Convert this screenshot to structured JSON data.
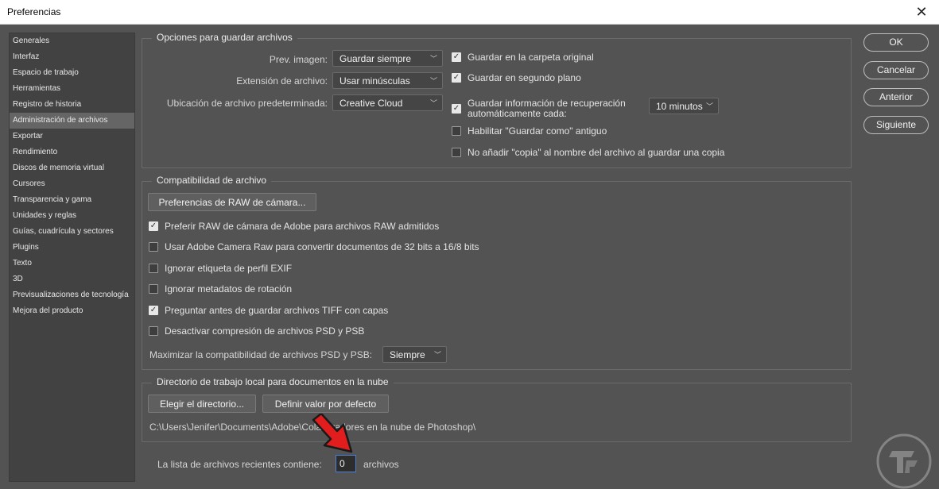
{
  "window": {
    "title": "Preferencias",
    "close": "✕"
  },
  "sidebar": {
    "items": [
      "Generales",
      "Interfaz",
      "Espacio de trabajo",
      "Herramientas",
      "Registro de historia",
      "Administración de archivos",
      "Exportar",
      "Rendimiento",
      "Discos de memoria virtual",
      "Cursores",
      "Transparencia y gama",
      "Unidades y reglas",
      "Guías, cuadrícula y sectores",
      "Plugins",
      "Texto",
      "3D",
      "Previsualizaciones de tecnología",
      "Mejora del producto"
    ],
    "selected_index": 5
  },
  "save_options": {
    "legend": "Opciones para guardar archivos",
    "prev_label": "Prev. imagen:",
    "prev_value": "Guardar siempre",
    "ext_label": "Extensión de archivo:",
    "ext_value": "Usar minúsculas",
    "loc_label": "Ubicación de archivo predeterminada:",
    "loc_value": "Creative Cloud",
    "cb_original": "Guardar en la carpeta original",
    "cb_background": "Guardar en segundo plano",
    "cb_recovery_l1": "Guardar información de recuperación",
    "cb_recovery_l2": "automáticamente cada:",
    "recovery_interval": "10 minutos",
    "cb_legacy": "Habilitar \"Guardar como\" antiguo",
    "cb_nocopy": "No añadir \"copia\" al nombre del archivo al guardar una copia",
    "checked": {
      "original": true,
      "background": true,
      "recovery": true,
      "legacy": false,
      "nocopy": false
    }
  },
  "compat": {
    "legend": "Compatibilidad de archivo",
    "raw_button": "Preferencias de RAW de cámara...",
    "cb_prefer_raw": "Preferir RAW de cámara de Adobe para archivos RAW admitidos",
    "cb_use_acr": "Usar Adobe Camera Raw para convertir documentos de 32 bits a 16/8 bits",
    "cb_exif": "Ignorar etiqueta de perfil EXIF",
    "cb_rotation": "Ignorar metadatos de rotación",
    "cb_tiff": "Preguntar antes de guardar archivos TIFF con capas",
    "cb_psd_comp": "Desactivar compresión de archivos PSD y PSB",
    "maximize_label": "Maximizar la compatibilidad de archivos PSD y PSB:",
    "maximize_value": "Siempre",
    "checked": {
      "prefer_raw": true,
      "use_acr": false,
      "exif": false,
      "rotation": false,
      "tiff": true,
      "psd_comp": false
    }
  },
  "cloud": {
    "legend": "Directorio de trabajo local para documentos en la nube",
    "choose_button": "Elegir el directorio...",
    "default_button": "Definir valor por defecto",
    "path": "C:\\Users\\Jenifer\\Documents\\Adobe\\Colaboradores en la nube de Photoshop\\"
  },
  "recent": {
    "label": "La lista de archivos recientes contiene:",
    "value": "0",
    "unit": "archivos"
  },
  "buttons": {
    "ok": "OK",
    "cancel": "Cancelar",
    "previous": "Anterior",
    "next": "Siguiente"
  },
  "colors": {
    "dialog_bg": "#535353",
    "sidebar_bg": "#424242",
    "selected_bg": "#656565",
    "arrow": "#e11d1d",
    "focus": "#4f7fd0"
  }
}
